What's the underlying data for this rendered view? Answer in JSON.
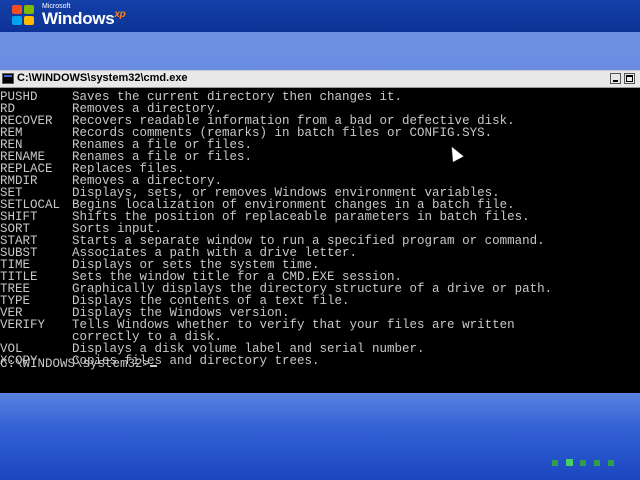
{
  "desktop": {
    "logo_small": "Microsoft",
    "logo_text": "Windows",
    "logo_xp": "xp"
  },
  "window": {
    "title": "C:\\WINDOWS\\system32\\cmd.exe",
    "icon": "console-icon"
  },
  "console": {
    "lines": [
      {
        "cmd": "PUSHD",
        "desc": "Saves the current directory then changes it."
      },
      {
        "cmd": "RD",
        "desc": "Removes a directory."
      },
      {
        "cmd": "RECOVER",
        "desc": "Recovers readable information from a bad or defective disk."
      },
      {
        "cmd": "REM",
        "desc": "Records comments (remarks) in batch files or CONFIG.SYS."
      },
      {
        "cmd": "REN",
        "desc": "Renames a file or files."
      },
      {
        "cmd": "RENAME",
        "desc": "Renames a file or files."
      },
      {
        "cmd": "REPLACE",
        "desc": "Replaces files."
      },
      {
        "cmd": "RMDIR",
        "desc": "Removes a directory."
      },
      {
        "cmd": "SET",
        "desc": "Displays, sets, or removes Windows environment variables."
      },
      {
        "cmd": "SETLOCAL",
        "desc": "Begins localization of environment changes in a batch file."
      },
      {
        "cmd": "SHIFT",
        "desc": "Shifts the position of replaceable parameters in batch files."
      },
      {
        "cmd": "SORT",
        "desc": "Sorts input."
      },
      {
        "cmd": "START",
        "desc": "Starts a separate window to run a specified program or command."
      },
      {
        "cmd": "SUBST",
        "desc": "Associates a path with a drive letter."
      },
      {
        "cmd": "TIME",
        "desc": "Displays or sets the system time."
      },
      {
        "cmd": "TITLE",
        "desc": "Sets the window title for a CMD.EXE session."
      },
      {
        "cmd": "TREE",
        "desc": "Graphically displays the directory structure of a drive or path."
      },
      {
        "cmd": "TYPE",
        "desc": "Displays the contents of a text file."
      },
      {
        "cmd": "VER",
        "desc": "Displays the Windows version."
      },
      {
        "cmd": "VERIFY",
        "desc": "Tells Windows whether to verify that your files are written"
      },
      {
        "cmd": "",
        "desc": "correctly to a disk."
      },
      {
        "cmd": "VOL",
        "desc": "Displays a disk volume label and serial number."
      },
      {
        "cmd": "XCOPY",
        "desc": "Copies files and directory trees."
      }
    ],
    "prompt": "C:\\WINDOWS\\system32>"
  },
  "progress": {
    "dots": 5,
    "active_index": 1
  },
  "colors": {
    "console_bg": "#000000",
    "console_text": "#c8c8c8",
    "setup_blue": "#1c4bc4",
    "progress_green": "#46d06a"
  }
}
